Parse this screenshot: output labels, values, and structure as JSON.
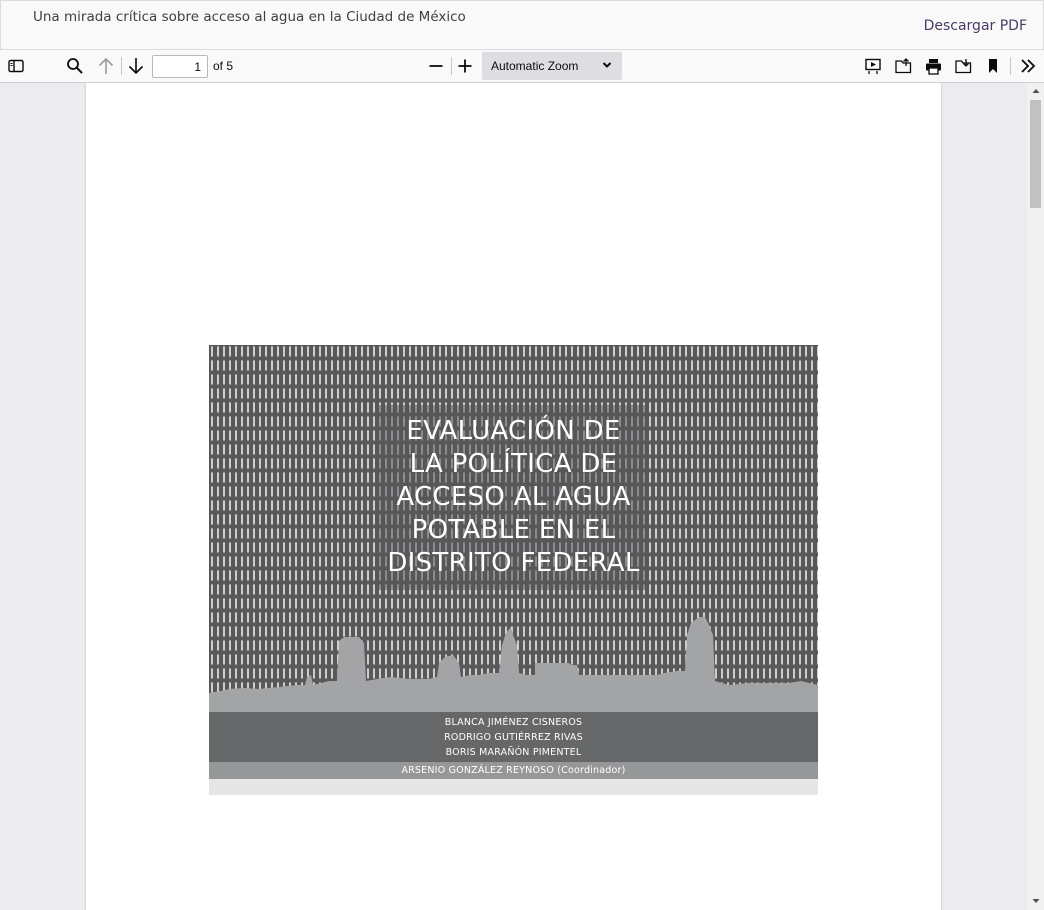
{
  "header": {
    "title": "Una mirada crítica sobre acceso al agua en la Ciudad de México",
    "download_label": "Descargar PDF"
  },
  "toolbar": {
    "page_number": "1",
    "page_count": "of 5",
    "zoom_label": "Automatic Zoom",
    "icons": [
      "sidebar-toggle-icon",
      "search-icon",
      "arrow-up-icon",
      "arrow-down-icon",
      "zoom-out-icon",
      "zoom-in-icon",
      "chevron-down-icon",
      "presentation-mode-icon",
      "open-file-icon",
      "print-icon",
      "save-icon",
      "bookmark-icon",
      "double-chevron-right-icon"
    ]
  },
  "document": {
    "cover": {
      "title_lines": [
        "EVALUACIÓN DE",
        "LA POLÍTICA DE",
        "ACCESO AL AGUA",
        "POTABLE EN EL",
        "DISTRITO FEDERAL"
      ],
      "authors": [
        "BLANCA JIMÉNEZ CISNEROS",
        "RODRIGO GUTIÉRREZ RIVAS",
        "BORIS MARAÑÓN PIMENTEL"
      ],
      "coordinator": "ARSENIO GONZÁLEZ REYNOSO (Coordinador)"
    }
  },
  "colors": {
    "toolbar_bg": "#f9f9fa",
    "viewer_bg": "#ececee",
    "cover_dark": "#58585a",
    "skyline": "#a3a4a6",
    "authors_band": "#666769",
    "coordinator_band": "#969799",
    "link": "#4a3b66"
  }
}
